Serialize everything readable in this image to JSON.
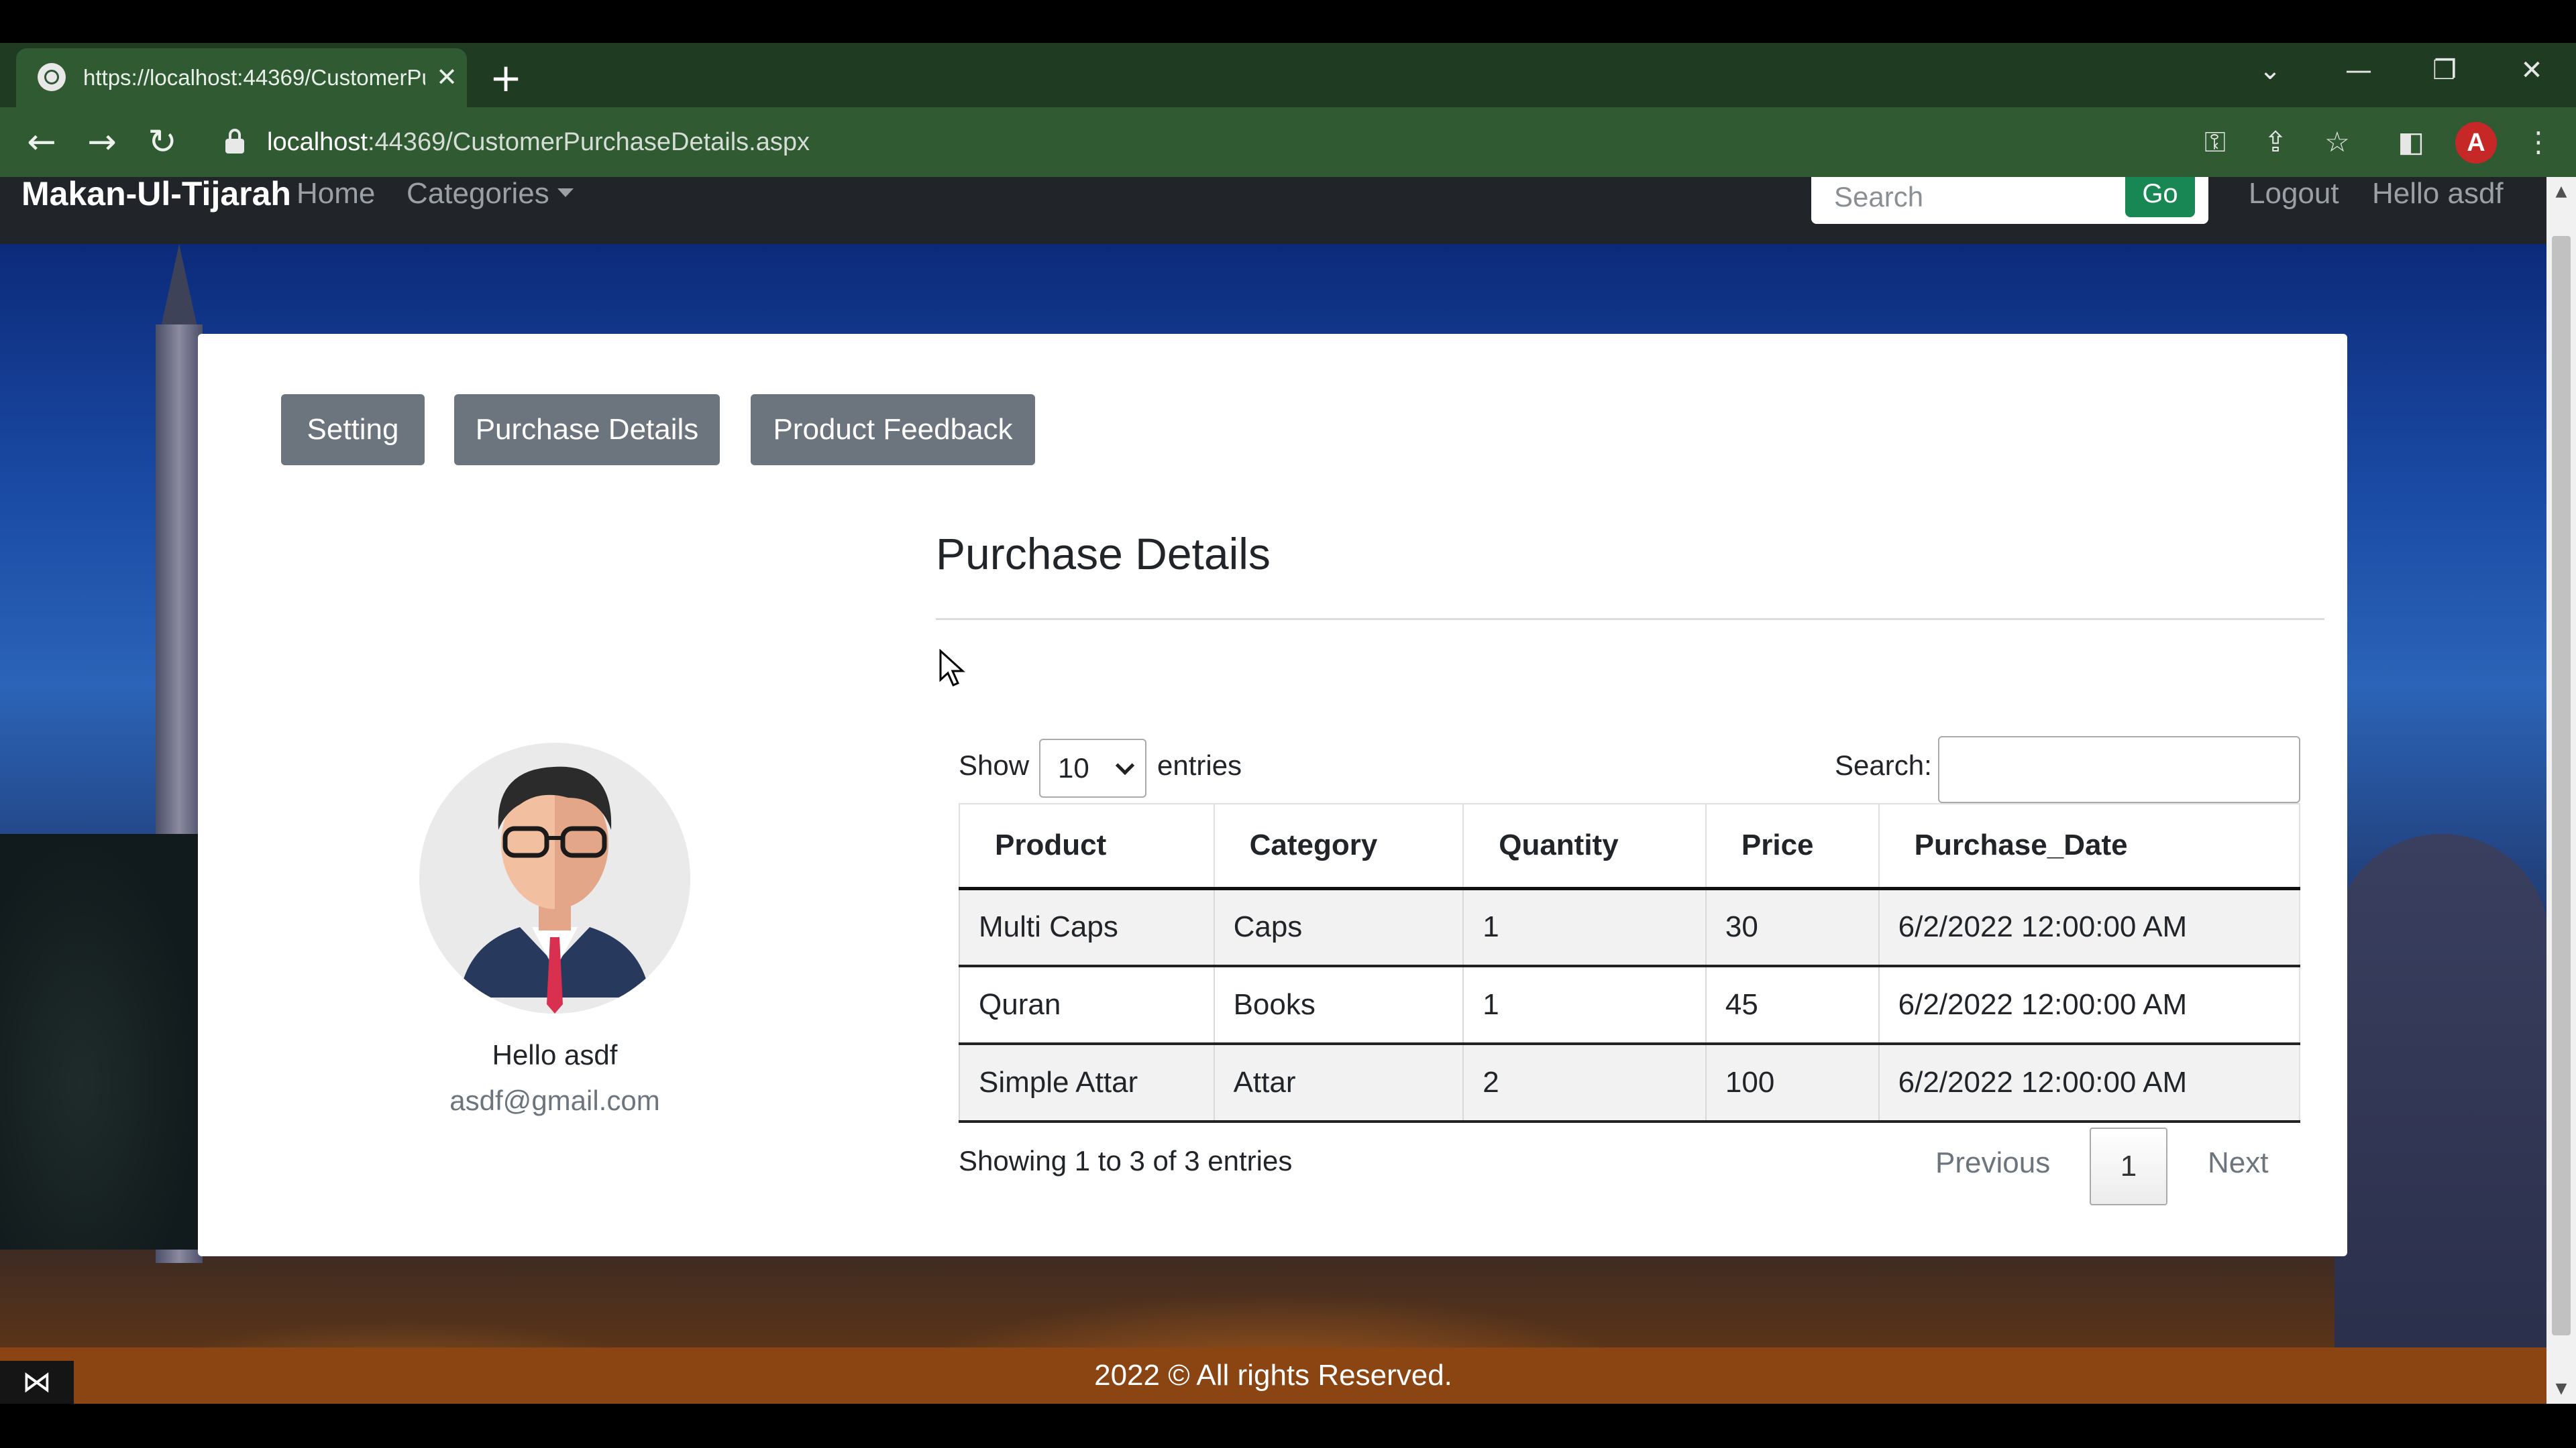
{
  "browser": {
    "tab_title": "https://localhost:44369/CustomerPurchaseDetails.aspx",
    "tab_close": "✕",
    "new_tab": "+",
    "url_host": "localhost",
    "url_rest": ":44369/CustomerPurchaseDetails.aspx",
    "controls": {
      "dropdown": "⌄",
      "minimize": "—",
      "restore": "❐",
      "close": "✕"
    },
    "nav": {
      "back": "←",
      "forward": "→",
      "reload": "↻"
    },
    "toolbar_icons": [
      "key-icon",
      "share-icon",
      "star-icon",
      "sidepanel-icon",
      "profile-avatar",
      "menu-icon"
    ],
    "profile_letter": "A"
  },
  "site": {
    "brand": "Makan-Ul-Tijarah",
    "nav_home": "Home",
    "nav_categories": "Categories",
    "search_placeholder": "Search",
    "go_label": "Go",
    "logout": "Logout",
    "greeting": "Hello asdf"
  },
  "profile": {
    "buttons": [
      "Setting",
      "Purchase Details",
      "Product Feedback"
    ],
    "hello": "Hello asdf",
    "email": "asdf@gmail.com"
  },
  "purchase": {
    "title": "Purchase Details",
    "show_label": "Show",
    "entries_value": "10",
    "entries_label": "entries",
    "search_label": "Search:",
    "columns": [
      "Product",
      "Category",
      "Quantity",
      "Price",
      "Purchase_Date"
    ],
    "rows": [
      [
        "Multi Caps",
        "Caps",
        "1",
        "30",
        "6/2/2022 12:00:00 AM"
      ],
      [
        "Quran",
        "Books",
        "1",
        "45",
        "6/2/2022 12:00:00 AM"
      ],
      [
        "Simple Attar",
        "Attar",
        "2",
        "100",
        "6/2/2022 12:00:00 AM"
      ]
    ],
    "info": "Showing 1 to 3 of 3 entries",
    "previous": "Previous",
    "page": "1",
    "next": "Next"
  },
  "footer": {
    "text": "2022 © All rights Reserved."
  },
  "colors": {
    "tab_bar": "#1f3c22",
    "toolbar": "#2f5a32",
    "navbar": "#212529",
    "go_button": "#198754",
    "profile_buttons": "#6c757d",
    "footer": "#8b4513"
  }
}
